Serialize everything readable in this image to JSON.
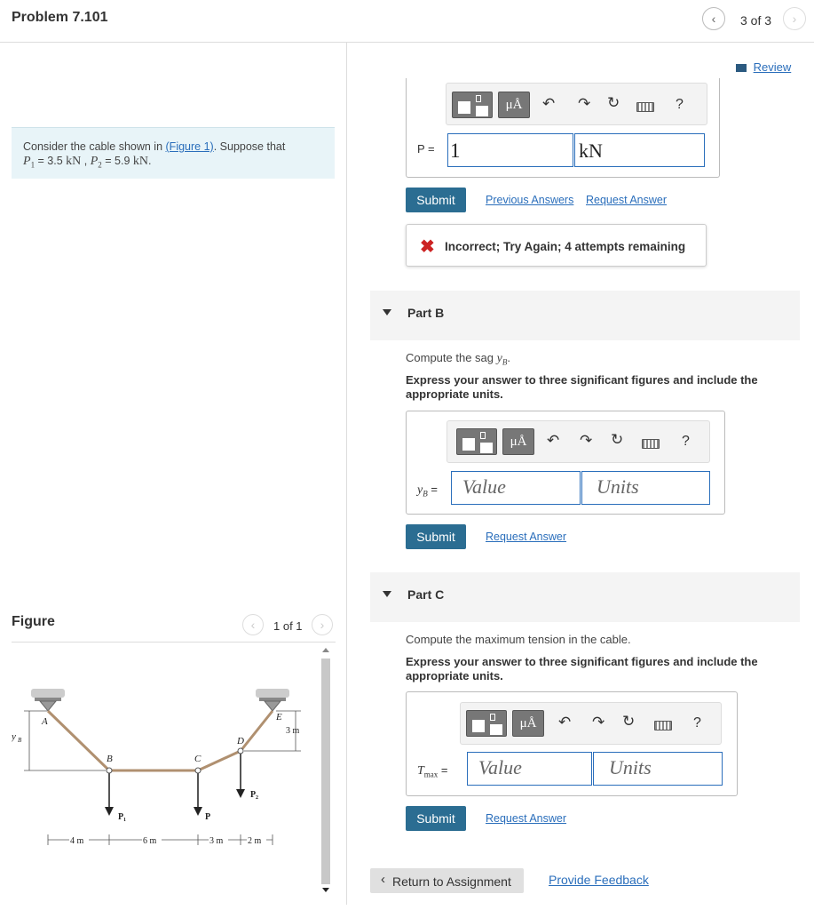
{
  "header": {
    "title": "Problem 7.101",
    "page_indicator": "3 of 3",
    "prev_icon": "chevron-left-icon",
    "next_icon": "chevron-right-icon"
  },
  "review": {
    "label": "Review",
    "icon": "book-icon"
  },
  "intro": {
    "text_before": "Consider the cable shown in ",
    "figure_link": "(Figure 1)",
    "text_after": ". Suppose that",
    "p1_label": "P",
    "p1_sub": "1",
    "p1_eq": " = 3.5 ",
    "p1_unit": "kN",
    "sep": " , ",
    "p2_label": "P",
    "p2_sub": "2",
    "p2_eq": " = 5.9 ",
    "p2_unit": "kN",
    "end": "."
  },
  "figure": {
    "label": "Figure",
    "page": "1 of 1",
    "labels": {
      "A": "A",
      "B": "B",
      "C": "C",
      "D": "D",
      "E": "E",
      "yB": "y",
      "yB_sub": "B",
      "P1": "P",
      "P1_sub": "1",
      "P": "P",
      "P2": "P",
      "P2_sub": "2",
      "dim_3m_vert": "3 m",
      "dim_4m": "4 m",
      "dim_6m": "6 m",
      "dim_3m": "3 m",
      "dim_2m": "2 m"
    }
  },
  "part_a": {
    "var_label": "P =",
    "value": "1",
    "unit": "kN",
    "submit": "Submit",
    "previous_answers": "Previous Answers",
    "request_answer": "Request Answer",
    "feedback": "Incorrect; Try Again; 4 attempts remaining",
    "feedback_icon": "x-mark-icon"
  },
  "toolbar": {
    "mu_label": "μÅ",
    "help_label": "?",
    "undo_icon": "undo-icon",
    "redo_icon": "redo-icon",
    "reset_icon": "reset-icon",
    "keyboard_icon": "keyboard-icon"
  },
  "part_b": {
    "title": "Part B",
    "question_prefix": "Compute the sag ",
    "question_var": "y",
    "question_sub": "B",
    "question_suffix": ".",
    "instruction": "Express your answer to three significant figures and include the appropriate units.",
    "var_label": "y",
    "var_sub": "B",
    "var_eq": " =",
    "value_placeholder": "Value",
    "units_placeholder": "Units",
    "submit": "Submit",
    "request_answer": "Request Answer"
  },
  "part_c": {
    "title": "Part C",
    "question": "Compute the maximum tension in the cable.",
    "instruction": "Express your answer to three significant figures and include the appropriate units.",
    "var_label": "T",
    "var_sub": "max",
    "var_eq": " =",
    "value_placeholder": "Value",
    "units_placeholder": "Units",
    "submit": "Submit",
    "request_answer": "Request Answer"
  },
  "footer": {
    "return_label": "Return to Assignment",
    "feedback_link": "Provide Feedback"
  },
  "colors": {
    "accent": "#2b6d92",
    "link": "#2a6ebb",
    "error": "#cc2222",
    "intro_bg": "#e8f4f8"
  }
}
